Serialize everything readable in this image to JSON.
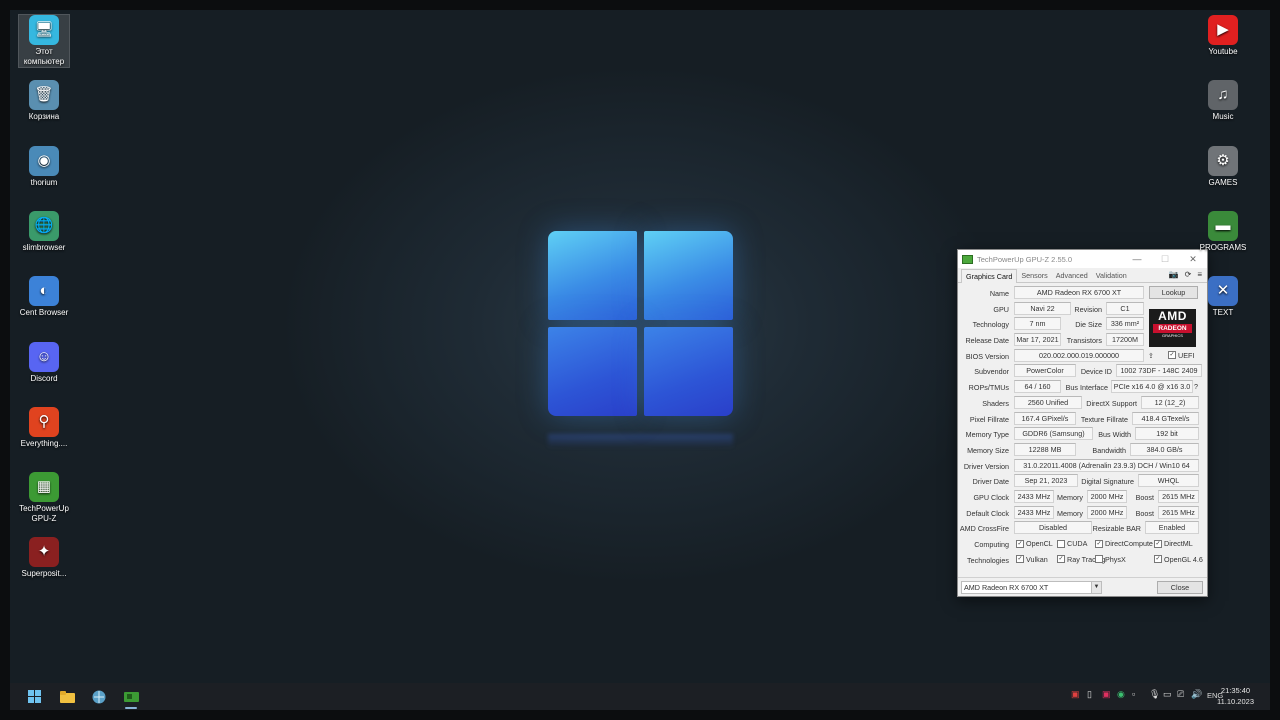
{
  "desktop_icons_left": [
    {
      "name": "Этот компьютер",
      "glyph": "🖥",
      "color": "#35b8e0"
    },
    {
      "name": "Корзина",
      "glyph": "🗑",
      "color": "#5a8fb0"
    },
    {
      "name": "thorium",
      "glyph": "◉",
      "color": "#4a8ab8"
    },
    {
      "name": "slimbrowser",
      "glyph": "🌐",
      "color": "#3a9a6a"
    },
    {
      "name": "Cent Browser",
      "glyph": "◐",
      "color": "#3c82d8"
    },
    {
      "name": "Discord",
      "glyph": "☺",
      "color": "#5865f2"
    },
    {
      "name": "Everything....",
      "glyph": "⚲",
      "color": "#e0431f"
    },
    {
      "name": "TechPowerUp GPU-Z",
      "glyph": "▦",
      "color": "#3c9a34"
    },
    {
      "name": "Superposit...",
      "glyph": "✦",
      "color": "#8a2020"
    }
  ],
  "desktop_icons_right": [
    {
      "name": "Youtube",
      "glyph": "▶",
      "color": "#e02020"
    },
    {
      "name": "Music",
      "glyph": "♫",
      "color": "#606468"
    },
    {
      "name": "GAMES",
      "glyph": "⚙",
      "color": "#707478"
    },
    {
      "name": "PROGRAMS",
      "glyph": "▬",
      "color": "#3a8a3a"
    },
    {
      "name": "TEXT",
      "glyph": "✕",
      "color": "#3b6fc4"
    }
  ],
  "gpuz": {
    "title": "TechPowerUp GPU-Z 2.55.0",
    "tabs": [
      "Graphics Card",
      "Sensors",
      "Advanced",
      "Validation"
    ],
    "fields": {
      "name_label": "Name",
      "name": "AMD Radeon RX 6700 XT",
      "lookup": "Lookup",
      "gpu_label": "GPU",
      "gpu": "Navi 22",
      "revision_label": "Revision",
      "revision": "C1",
      "technology_label": "Technology",
      "technology": "7 nm",
      "die_size_label": "Die Size",
      "die_size": "336 mm²",
      "release_label": "Release Date",
      "release": "Mar 17, 2021",
      "transistors_label": "Transistors",
      "transistors": "17200M",
      "bios_label": "BIOS Version",
      "bios": "020.002.000.019.000000",
      "uefi": "UEFI",
      "subvendor_label": "Subvendor",
      "subvendor": "PowerColor",
      "device_id_label": "Device ID",
      "device_id": "1002 73DF - 148C 2409",
      "rops_label": "ROPs/TMUs",
      "rops": "64 / 160",
      "bus_label": "Bus Interface",
      "bus": "PCIe x16 4.0 @ x16 3.0",
      "shaders_label": "Shaders",
      "shaders": "2560 Unified",
      "dx_label": "DirectX Support",
      "dx": "12 (12_2)",
      "pixel_label": "Pixel Fillrate",
      "pixel": "167.4 GPixel/s",
      "texture_label": "Texture Fillrate",
      "texture": "418.4 GTexel/s",
      "memtype_label": "Memory Type",
      "memtype": "GDDR6 (Samsung)",
      "buswidth_label": "Bus Width",
      "buswidth": "192 bit",
      "memsize_label": "Memory Size",
      "memsize": "12288 MB",
      "bandwidth_label": "Bandwidth",
      "bandwidth": "384.0 GB/s",
      "driver_label": "Driver Version",
      "driver": "31.0.22011.4008 (Adrenalin 23.9.3) DCH / Win10 64",
      "driverdate_label": "Driver Date",
      "driverdate": "Sep 21, 2023",
      "digsig_label": "Digital Signature",
      "digsig": "WHQL",
      "gpuclock_label": "GPU Clock",
      "gpuclock": "2433 MHz",
      "memory_label": "Memory",
      "memclock": "2000 MHz",
      "boost_label": "Boost",
      "boost": "2615 MHz",
      "defclock_label": "Default Clock",
      "defclock": "2433 MHz",
      "defmem": "2000 MHz",
      "defboost": "2615 MHz",
      "crossfire_label": "AMD CrossFire",
      "crossfire": "Disabled",
      "rebar_label": "Resizable BAR",
      "rebar": "Enabled",
      "computing_label": "Computing",
      "technologies_label": "Technologies"
    },
    "computing": [
      {
        "label": "OpenCL",
        "checked": true
      },
      {
        "label": "CUDA",
        "checked": false
      },
      {
        "label": "DirectCompute",
        "checked": true
      },
      {
        "label": "DirectML",
        "checked": true
      }
    ],
    "technologies": [
      {
        "label": "Vulkan",
        "checked": true
      },
      {
        "label": "Ray Tracing",
        "checked": true
      },
      {
        "label": "PhysX",
        "checked": false
      },
      {
        "label": "OpenGL 4.6",
        "checked": true
      }
    ],
    "logo": {
      "brand": "AMD",
      "line1": "RADEON",
      "line2": "GRAPHICS"
    },
    "selected_card": "AMD Radeon RX 6700 XT",
    "close": "Close"
  },
  "taskbar": {
    "language": "ENG",
    "time": "21:35:40",
    "date": "11.10.2023"
  }
}
